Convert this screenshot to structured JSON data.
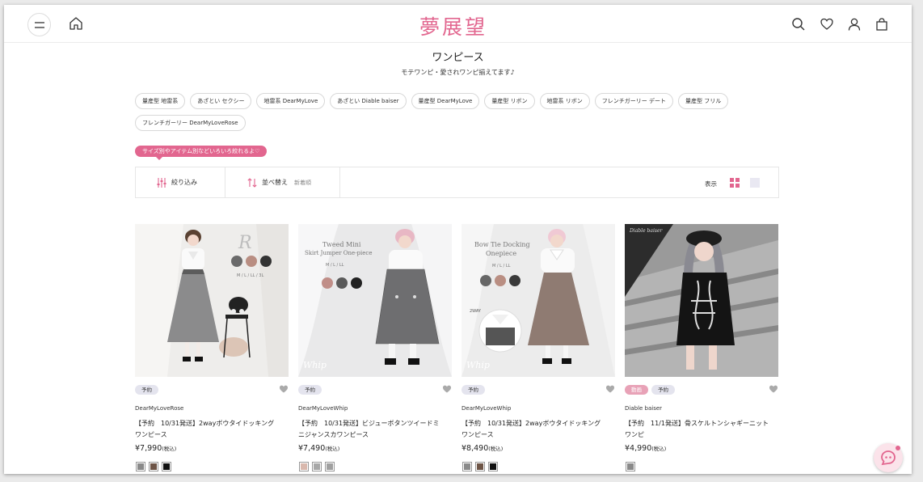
{
  "header": {
    "logo": "夢展望",
    "icons": [
      "menu-icon",
      "home-icon",
      "search-icon",
      "heart-icon",
      "user-icon",
      "bag-icon"
    ]
  },
  "page": {
    "title": "ワンピース",
    "subtitle": "モテワンピ・愛されワンピ揃えてます♪"
  },
  "tags": [
    "量産型 地雷系",
    "あざとい セクシー",
    "地雷系 DearMyLove",
    "あざとい Diable baiser",
    "量産型 DearMyLove",
    "量産型 リボン",
    "地雷系 リボン",
    "フレンチガーリー デート",
    "量産型 フリル",
    "フレンチガーリー DearMyLoveRose"
  ],
  "promo": "サイズ別やアイテム別などいろいろ絞れるよ♡",
  "filter": {
    "narrow_label": "絞り込み",
    "sort_label": "並べ替え",
    "sort_value": "新着順",
    "view_label": "表示"
  },
  "colors": {
    "accent": "#e2668f",
    "badge": "#e4e4ee",
    "badge_pink": "#e8a2b7"
  },
  "products": [
    {
      "badges": [
        "予約"
      ],
      "badge_types": [
        "plain"
      ],
      "brand": "DearMyLoveRose",
      "name": "【予約　10/31発送】2wayボウタイドッキングワンピース",
      "price": "¥7,990",
      "tax": "(税込)",
      "image_text": [
        "R",
        "M / L / LL / 3L"
      ],
      "swatches": [
        "#8a8a8a",
        "#6e5547",
        "#111111"
      ]
    },
    {
      "badges": [
        "予約"
      ],
      "badge_types": [
        "plain"
      ],
      "brand": "DearMyLoveWhip",
      "name": "【予約　10/31発送】ビジューボタンツイードミニジャンスカワンピース",
      "price": "¥7,490",
      "tax": "(税込)",
      "image_text": [
        "Tweed Mini",
        "Skirt Jumper One-piece",
        "M / L / LL",
        "Whip"
      ],
      "swatches": [
        "#d9b8ad",
        "#a8a8a8",
        "#a0a0a0"
      ]
    },
    {
      "badges": [
        "予約"
      ],
      "badge_types": [
        "plain"
      ],
      "brand": "DearMyLoveWhip",
      "name": "【予約　10/31発送】2wayボウタイドッキングワンピース",
      "price": "¥8,490",
      "tax": "(税込)",
      "image_text": [
        "Bow Tie Docking",
        "Onepiece",
        "M / L / LL",
        "2WAY",
        "Whip"
      ],
      "swatches": [
        "#8a8a8a",
        "#6e5547",
        "#111111"
      ]
    },
    {
      "badges": [
        "動画",
        "予約"
      ],
      "badge_types": [
        "pink",
        "plain"
      ],
      "brand": "Diable baiser",
      "name": "【予約　11/1発送】骨スケルトンシャギーニットワンピ",
      "price": "¥4,990",
      "tax": "(税込)",
      "image_text": [
        "Diable baiser"
      ],
      "swatches": [
        "#8a8a8a"
      ]
    }
  ]
}
